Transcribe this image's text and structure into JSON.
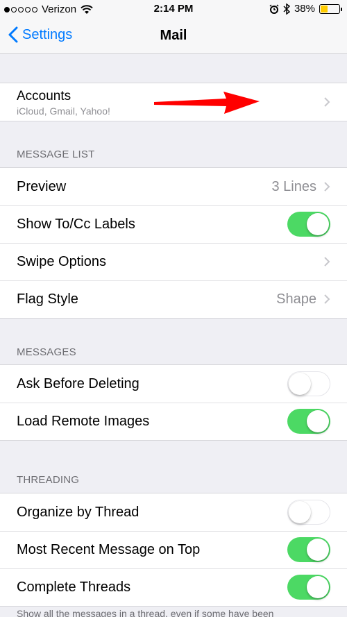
{
  "status_bar": {
    "carrier": "Verizon",
    "time": "2:14 PM",
    "battery_percent": "38%",
    "battery_level": 0.38,
    "battery_color": "#ffcc00",
    "signal_icon": "signal-dots-icon",
    "wifi_icon": "wifi-icon",
    "alarm_icon": "alarm-icon",
    "bluetooth_icon": "bluetooth-icon"
  },
  "nav": {
    "back_label": "Settings",
    "title": "Mail",
    "accent_color": "#007aff"
  },
  "accounts": {
    "title": "Accounts",
    "subtitle": "iCloud, Gmail, Yahoo!"
  },
  "message_list": {
    "header": "MESSAGE LIST",
    "preview_label": "Preview",
    "preview_value": "3 Lines",
    "show_to_cc_label": "Show To/Cc Labels",
    "show_to_cc_on": true,
    "swipe_options_label": "Swipe Options",
    "flag_style_label": "Flag Style",
    "flag_style_value": "Shape"
  },
  "messages": {
    "header": "MESSAGES",
    "ask_before_deleting_label": "Ask Before Deleting",
    "ask_before_deleting_on": false,
    "load_remote_images_label": "Load Remote Images",
    "load_remote_images_on": true
  },
  "threading": {
    "header": "THREADING",
    "organize_by_thread_label": "Organize by Thread",
    "organize_by_thread_on": false,
    "most_recent_on_top_label": "Most Recent Message on Top",
    "most_recent_on_top_on": true,
    "complete_threads_label": "Complete Threads",
    "complete_threads_on": true,
    "footer": "Show all the messages in a thread, even if some have been"
  },
  "colors": {
    "toggle_on": "#4cd964",
    "annotation_arrow": "#ff0000"
  }
}
